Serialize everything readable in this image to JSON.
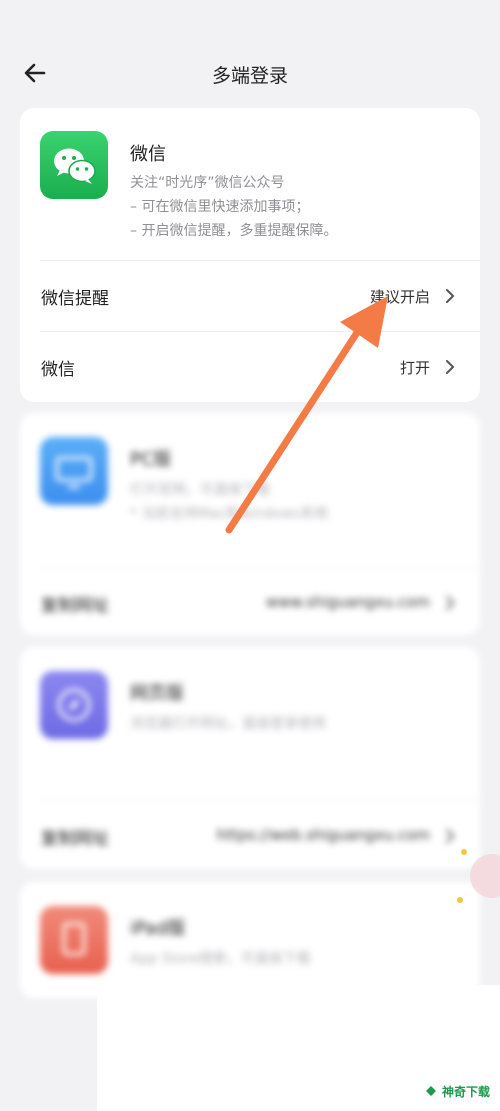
{
  "header": {
    "title": "多端登录"
  },
  "wechat": {
    "name": "微信",
    "desc": [
      "关注“时光序”微信公众号",
      "– 可在微信里快速添加事项；",
      "– 开启微信提醒，多重提醒保障。"
    ],
    "reminder": {
      "label": "微信提醒",
      "value": "建议开启"
    },
    "open": {
      "label": "微信",
      "value": "打开"
    }
  },
  "pc": {
    "name": "PC版",
    "desc": [
      "打开官网，可直接下载",
      "* 当前支持Mac和windows系统"
    ],
    "copy": {
      "label": "复制网址",
      "value": "www.shiguangxu.com"
    }
  },
  "web": {
    "name": "网页版",
    "desc": [
      "浏览器打开网址，直接登录使用"
    ],
    "copy": {
      "label": "复制网址",
      "value": "https://web.shiguangxu.com"
    }
  },
  "ipad": {
    "name": "iPad版",
    "desc": [
      "App Store搜索，可直接下载"
    ]
  },
  "watermark": {
    "text": "神奇下载"
  },
  "colors": {
    "accent_green": "#1aad4e",
    "arrow": "#f47b45"
  }
}
